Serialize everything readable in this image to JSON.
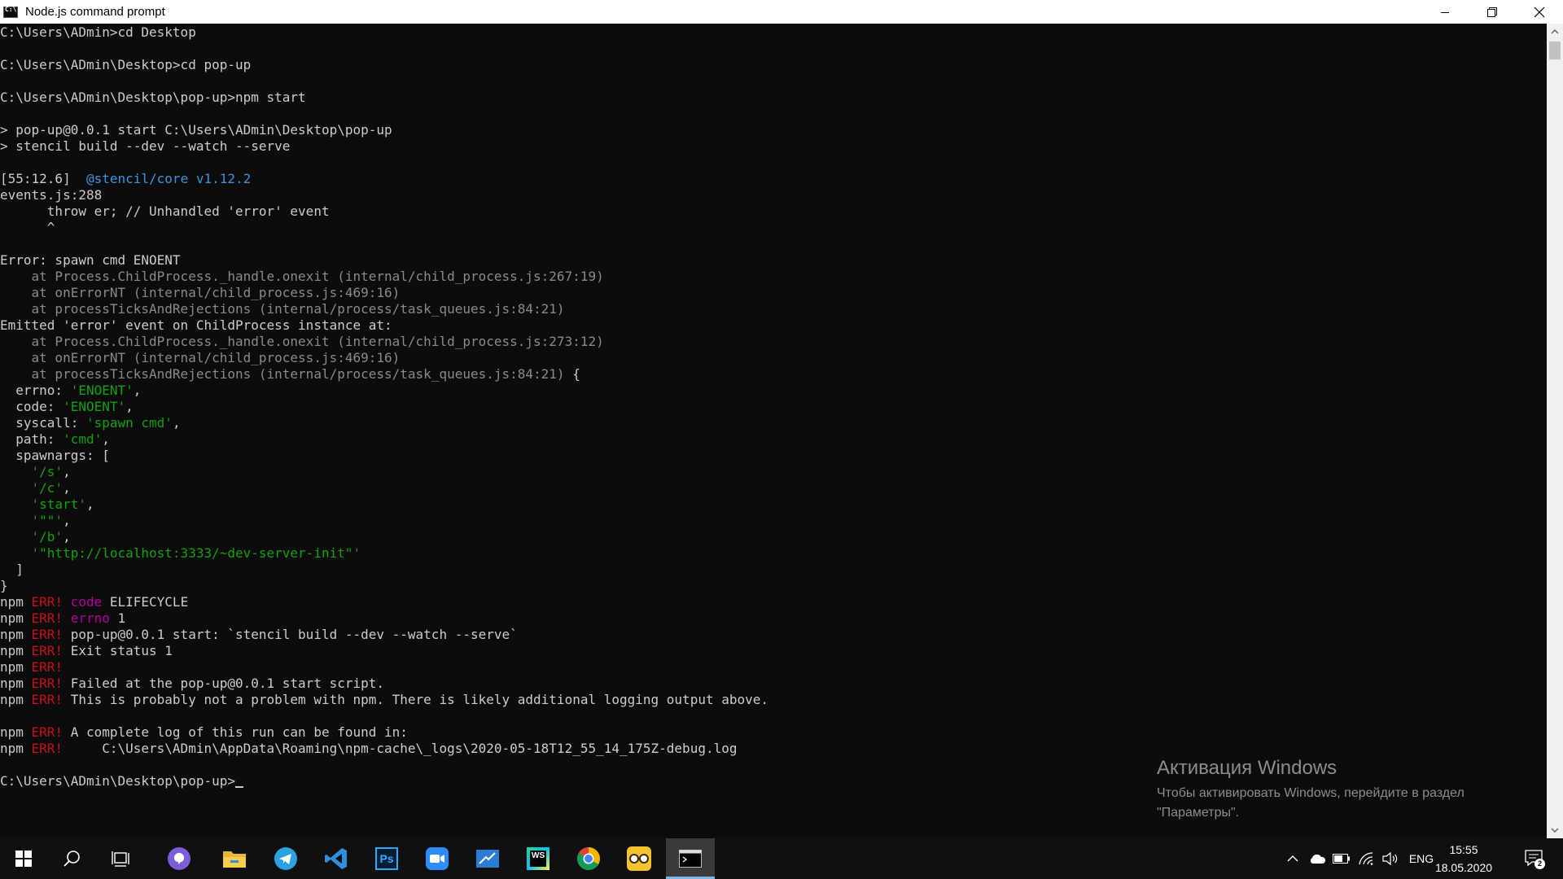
{
  "window": {
    "title": "Node.js command prompt",
    "controls": [
      "minimize",
      "restore",
      "close"
    ]
  },
  "terminal": {
    "lines": [
      [
        {
          "t": "C:\\Users\\ADmin>cd Desktop"
        }
      ],
      [],
      [
        {
          "t": "C:\\Users\\ADmin\\Desktop>cd pop-up"
        }
      ],
      [],
      [
        {
          "t": "C:\\Users\\ADmin\\Desktop\\pop-up>npm start"
        }
      ],
      [],
      [
        {
          "t": "> pop-up@0.0.1 start C:\\Users\\ADmin\\Desktop\\pop-up"
        }
      ],
      [
        {
          "t": "> stencil build --dev --watch --serve"
        }
      ],
      [],
      [
        {
          "t": "[55:12.6]  "
        },
        {
          "t": "@stencil/core v1.12.2",
          "c": "cyan"
        }
      ],
      [
        {
          "t": "events.js:288"
        }
      ],
      [
        {
          "t": "      throw er; // Unhandled 'error' event"
        }
      ],
      [
        {
          "t": "      ^"
        }
      ],
      [],
      [
        {
          "t": "Error: spawn cmd ENOENT"
        }
      ],
      [
        {
          "t": "    at Process.ChildProcess._handle.onexit (internal/child_process.js:267:19)",
          "c": "gray"
        }
      ],
      [
        {
          "t": "    at onErrorNT (internal/child_process.js:469:16)",
          "c": "gray"
        }
      ],
      [
        {
          "t": "    at processTicksAndRejections (internal/process/task_queues.js:84:21)",
          "c": "gray"
        }
      ],
      [
        {
          "t": "Emitted 'error' event on ChildProcess instance at:"
        }
      ],
      [
        {
          "t": "    at Process.ChildProcess._handle.onexit (internal/child_process.js:273:12)",
          "c": "gray"
        }
      ],
      [
        {
          "t": "    at onErrorNT (internal/child_process.js:469:16)",
          "c": "gray"
        }
      ],
      [
        {
          "t": "    at processTicksAndRejections (internal/process/task_queues.js:84:21)",
          "c": "gray"
        },
        {
          "t": " {"
        }
      ],
      [
        {
          "t": "  errno: "
        },
        {
          "t": "'ENOENT'",
          "c": "green"
        },
        {
          "t": ","
        }
      ],
      [
        {
          "t": "  code: "
        },
        {
          "t": "'ENOENT'",
          "c": "green"
        },
        {
          "t": ","
        }
      ],
      [
        {
          "t": "  syscall: "
        },
        {
          "t": "'spawn cmd'",
          "c": "green"
        },
        {
          "t": ","
        }
      ],
      [
        {
          "t": "  path: "
        },
        {
          "t": "'cmd'",
          "c": "green"
        },
        {
          "t": ","
        }
      ],
      [
        {
          "t": "  spawnargs: ["
        }
      ],
      [
        {
          "t": "    "
        },
        {
          "t": "'/s'",
          "c": "green"
        },
        {
          "t": ","
        }
      ],
      [
        {
          "t": "    "
        },
        {
          "t": "'/c'",
          "c": "green"
        },
        {
          "t": ","
        }
      ],
      [
        {
          "t": "    "
        },
        {
          "t": "'start'",
          "c": "green"
        },
        {
          "t": ","
        }
      ],
      [
        {
          "t": "    "
        },
        {
          "t": "'\"\"'",
          "c": "green"
        },
        {
          "t": ","
        }
      ],
      [
        {
          "t": "    "
        },
        {
          "t": "'/b'",
          "c": "green"
        },
        {
          "t": ","
        }
      ],
      [
        {
          "t": "    "
        },
        {
          "t": "'\"http://localhost:3333/~dev-server-init\"'",
          "c": "green"
        }
      ],
      [
        {
          "t": "  ]"
        }
      ],
      [
        {
          "t": "}"
        }
      ],
      [
        {
          "t": "npm "
        },
        {
          "t": "ERR!",
          "c": "red"
        },
        {
          "t": " "
        },
        {
          "t": "code",
          "c": "magenta"
        },
        {
          "t": " ELIFECYCLE"
        }
      ],
      [
        {
          "t": "npm "
        },
        {
          "t": "ERR!",
          "c": "red"
        },
        {
          "t": " "
        },
        {
          "t": "errno",
          "c": "magenta"
        },
        {
          "t": " 1"
        }
      ],
      [
        {
          "t": "npm "
        },
        {
          "t": "ERR!",
          "c": "red"
        },
        {
          "t": " pop-up@0.0.1 start: `stencil build --dev --watch --serve`"
        }
      ],
      [
        {
          "t": "npm "
        },
        {
          "t": "ERR!",
          "c": "red"
        },
        {
          "t": " Exit status 1"
        }
      ],
      [
        {
          "t": "npm "
        },
        {
          "t": "ERR!",
          "c": "red"
        }
      ],
      [
        {
          "t": "npm "
        },
        {
          "t": "ERR!",
          "c": "red"
        },
        {
          "t": " Failed at the pop-up@0.0.1 start script."
        }
      ],
      [
        {
          "t": "npm "
        },
        {
          "t": "ERR!",
          "c": "red"
        },
        {
          "t": " This is probably not a problem with npm. There is likely additional logging output above."
        }
      ],
      [],
      [
        {
          "t": "npm "
        },
        {
          "t": "ERR!",
          "c": "red"
        },
        {
          "t": " A complete log of this run can be found in:"
        }
      ],
      [
        {
          "t": "npm "
        },
        {
          "t": "ERR!",
          "c": "red"
        },
        {
          "t": "     C:\\Users\\ADmin\\AppData\\Roaming\\npm-cache\\_logs\\2020-05-18T12_55_14_175Z-debug.log"
        }
      ],
      [],
      [
        {
          "t": "C:\\Users\\ADmin\\Desktop\\pop-up>"
        }
      ]
    ]
  },
  "activation": {
    "title": "Активация Windows",
    "line1": "Чтобы активировать Windows, перейдите в раздел",
    "line2": "\"Параметры\"."
  },
  "taskbar": {
    "apps": [
      "start-icon",
      "search-icon",
      "task-view-icon",
      "viber-icon",
      "file-explorer-icon",
      "telegram-icon",
      "vscode-icon",
      "photoshop-icon",
      "zoom-icon",
      "whiteboard-icon",
      "webstorm-icon",
      "chrome-icon",
      "glasses-app-icon",
      "terminal-icon"
    ],
    "ps_label": "Ps",
    "ws_label": "WS",
    "tray": {
      "language": "ENG",
      "time": "15:55",
      "date": "18.05.2020",
      "notifications": "2"
    }
  },
  "colors": {
    "console_bg": "#0c0c0c",
    "console_fg": "#cccccc",
    "gray": "#8a8a8a",
    "green": "#13a10e",
    "cyan": "#3a96dd",
    "red": "#c50f1f",
    "magenta": "#b4009e",
    "taskbar_bg": "#101010"
  }
}
